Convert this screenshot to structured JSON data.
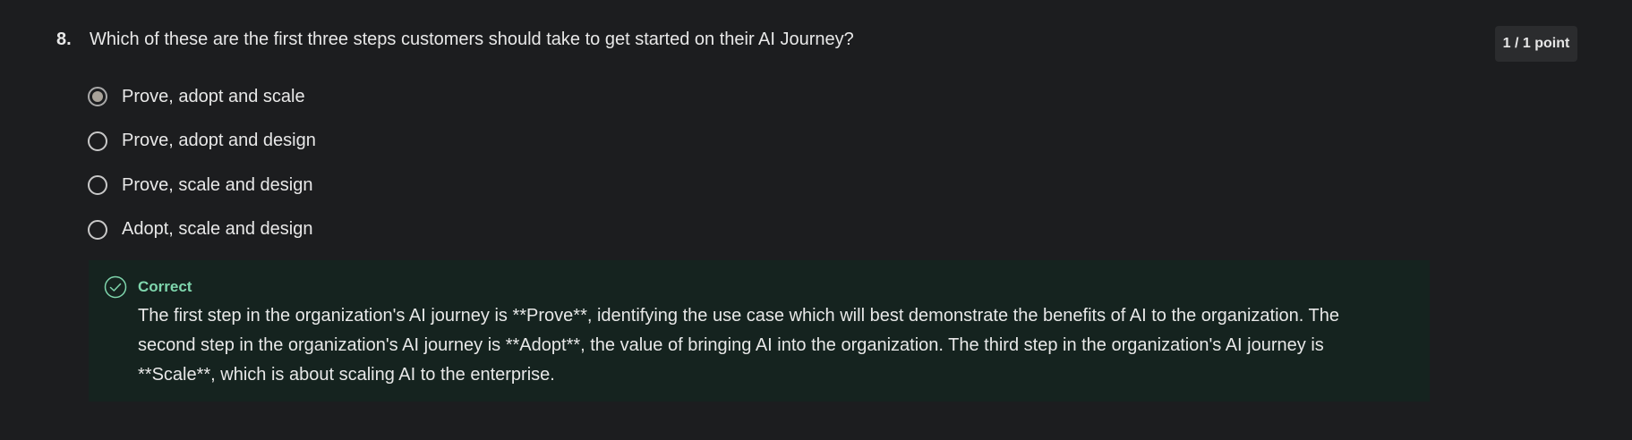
{
  "question": {
    "number": "8.",
    "text": "Which of these are the first three steps customers should take to get started on their AI Journey?",
    "points": "1 / 1 point",
    "options": [
      {
        "label": "Prove, adopt and scale",
        "selected": true
      },
      {
        "label": "Prove, adopt and design",
        "selected": false
      },
      {
        "label": "Prove, scale and design",
        "selected": false
      },
      {
        "label": "Adopt, scale and design",
        "selected": false
      }
    ]
  },
  "feedback": {
    "status": "Correct",
    "icon": "check-circle-icon",
    "text": "The first step in the organization's AI journey is **Prove**, identifying the use case which will best demonstrate the benefits of AI to the organization. The second step in the organization's AI journey is **Adopt**, the value of bringing AI into the organization. The third step in the organization's AI journey is **Scale**, which is about scaling AI to the enterprise.",
    "accent_color": "#7fd6ad",
    "background_color": "#15231f"
  }
}
